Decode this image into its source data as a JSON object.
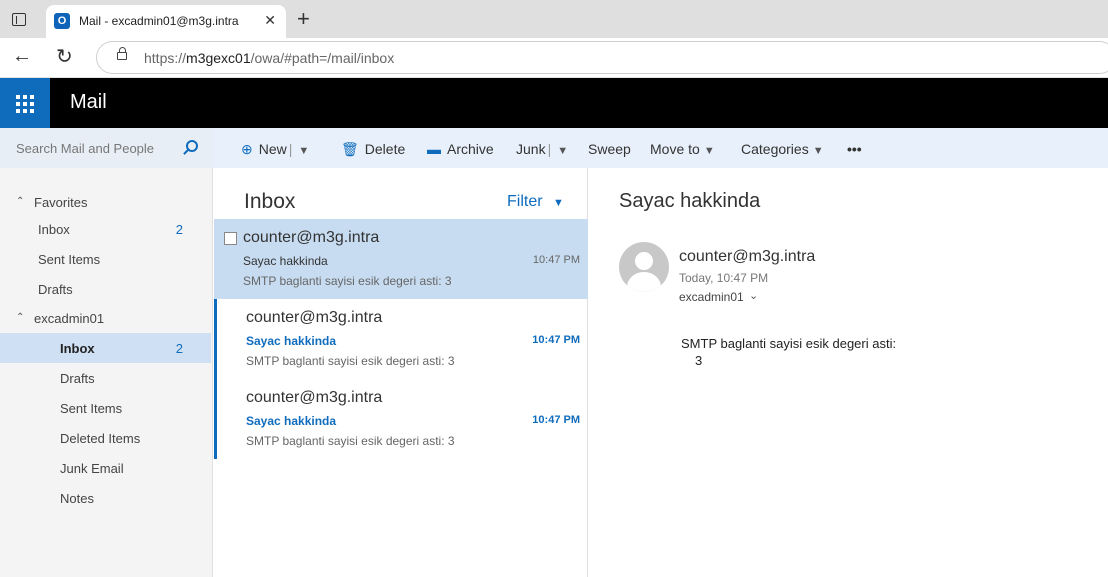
{
  "browser": {
    "tab_title": "Mail - excadmin01@m3g.intra",
    "tab_favicon": "O",
    "url_host": "m3gexc01",
    "url_prefix": "https://",
    "url_path": "/owa/#path=/mail/inbox"
  },
  "app": {
    "title": "Mail",
    "accent": "#0f6cbd"
  },
  "search": {
    "placeholder": "Search Mail and People"
  },
  "toolbar": {
    "new": "New",
    "delete": "Delete",
    "archive": "Archive",
    "junk": "Junk",
    "sweep": "Sweep",
    "move_to": "Move to",
    "categories": "Categories",
    "more": "•••"
  },
  "folders": {
    "favorites_header": "Favorites",
    "favorites": [
      {
        "label": "Inbox",
        "count": "2"
      },
      {
        "label": "Sent Items",
        "count": ""
      },
      {
        "label": "Drafts",
        "count": ""
      }
    ],
    "account_header": "excadmin01",
    "account": [
      {
        "label": "Inbox",
        "count": "2"
      },
      {
        "label": "Drafts",
        "count": ""
      },
      {
        "label": "Sent Items",
        "count": ""
      },
      {
        "label": "Deleted Items",
        "count": ""
      },
      {
        "label": "Junk Email",
        "count": ""
      },
      {
        "label": "Notes",
        "count": ""
      }
    ]
  },
  "list": {
    "title": "Inbox",
    "filter": "Filter",
    "messages": [
      {
        "from": "counter@m3g.intra",
        "subject": "Sayac hakkinda",
        "time": "10:47 PM",
        "preview": "SMTP baglanti sayisi esik degeri asti: 3"
      },
      {
        "from": "counter@m3g.intra",
        "subject": "Sayac hakkinda",
        "time": "10:47 PM",
        "preview": "SMTP baglanti sayisi esik degeri asti: 3"
      },
      {
        "from": "counter@m3g.intra",
        "subject": "Sayac hakkinda",
        "time": "10:47 PM",
        "preview": "SMTP baglanti sayisi esik degeri asti: 3"
      }
    ]
  },
  "reading": {
    "subject": "Sayac hakkinda",
    "from": "counter@m3g.intra",
    "date": "Today, 10:47 PM",
    "to": "excadmin01",
    "body_line1": "SMTP baglanti sayisi esik degeri asti:",
    "body_line2": "3"
  }
}
